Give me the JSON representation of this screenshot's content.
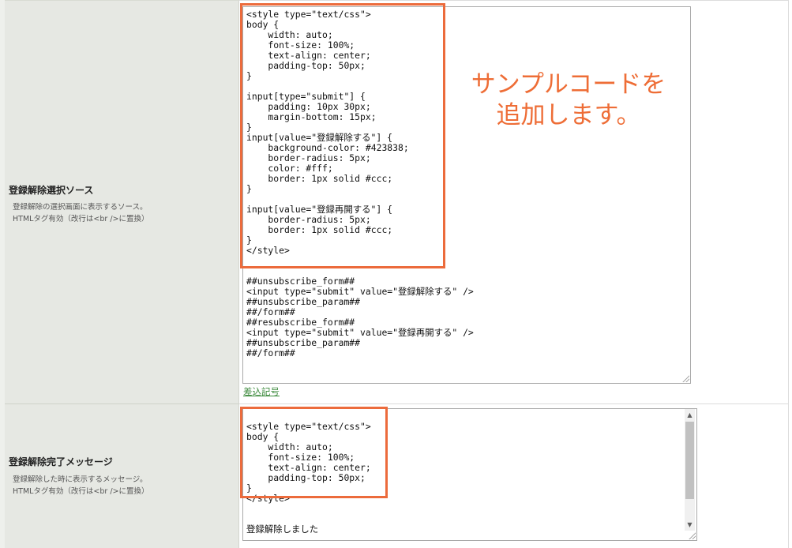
{
  "section1": {
    "title": "登録解除選択ソース",
    "desc_line1": "登録解除の選択画面に表示するソース。",
    "desc_line2": "HTMLタグ有効（改行は<br />に置換）",
    "code_lines": [
      "<style type=\"text/css\">",
      "body {",
      "    width: auto;",
      "    font-size: 100%;",
      "    text-align: center;",
      "    padding-top: 50px;",
      "}",
      "",
      "input[type=\"submit\"] {",
      "    padding: 10px 30px;",
      "    margin-bottom: 15px;",
      "}",
      "input[value=\"登録解除する\"] {",
      "    background-color: #423838;",
      "    border-radius: 5px;",
      "    color: #fff;",
      "    border: 1px solid #ccc;",
      "}",
      "",
      "input[value=\"登録再開する\"] {",
      "    border-radius: 5px;",
      "    border: 1px solid #ccc;",
      "}",
      "</style>",
      "",
      "",
      "##unsubscribe_form##",
      "<input type=\"submit\" value=\"登録解除する\" />",
      "##unsubscribe_param##",
      "##/form##",
      "##resubscribe_form##",
      "<input type=\"submit\" value=\"登録再開する\" />",
      "##unsubscribe_param##",
      "##/form##"
    ],
    "link_label": "差込記号"
  },
  "section2": {
    "title": "登録解除完了メッセージ",
    "desc_line1": "登録解除した時に表示するメッセージ。",
    "desc_line2": "HTMLタグ有効（改行は<br />に置換）",
    "code_lines": [
      "<style type=\"text/css\">",
      "body {",
      "    width: auto;",
      "    font-size: 100%;",
      "    text-align: center;",
      "    padding-top: 50px;",
      "}",
      "</style>",
      "",
      "",
      "登録解除しました"
    ]
  },
  "annotation": {
    "line1": "サンプルコードを",
    "line2": "追加します。"
  },
  "colors": {
    "highlight": "#ec6b3c",
    "annotation_text": "#ee6d36",
    "link": "#3c8a3c",
    "label_bg": "#e6e8e3"
  },
  "icons": {
    "scroll_up": "up-arrow-icon",
    "scroll_down": "down-arrow-icon",
    "resize": "resize-grip-icon"
  }
}
